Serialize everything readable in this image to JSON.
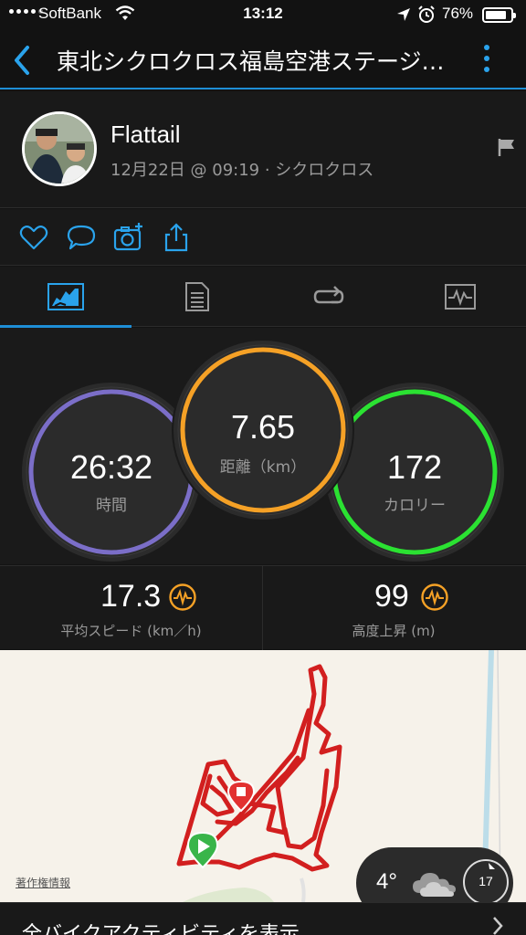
{
  "status_bar": {
    "carrier": "SoftBank",
    "time": "13:12",
    "battery": "76%"
  },
  "nav": {
    "title": "東北シクロクロス福島空港ステージ…"
  },
  "activity": {
    "user_name": "Flattail",
    "meta": "12月22日 @ 09:19 · シクロクロス"
  },
  "metrics": {
    "time": {
      "value": "26:32",
      "label": "時間",
      "color": "#7b6ec8"
    },
    "distance": {
      "value": "7.65",
      "label": "距離（km）",
      "color": "#f5a126"
    },
    "calories": {
      "value": "172",
      "label": "カロリー",
      "color": "#2be232"
    }
  },
  "stats": {
    "avg_speed": {
      "value": "17.3",
      "label": "平均スピード (km／h)"
    },
    "elevation_gain": {
      "value": "99",
      "label": "高度上昇 (m)"
    }
  },
  "map": {
    "copyright": "著作権情報",
    "weather_temp": "4°",
    "wind_speed": "17",
    "route_color": "#d21f1f"
  },
  "footer": {
    "link_text": "全バイクアクティビティを表示"
  },
  "colors": {
    "accent": "#1e8ed6",
    "icon_orange": "#f5a126"
  }
}
